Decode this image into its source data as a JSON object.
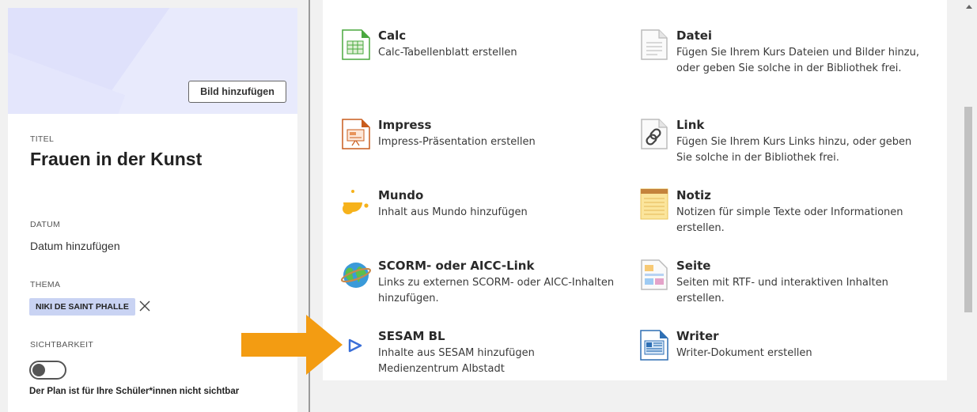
{
  "course": {
    "image_button": "Bild hinzufügen",
    "title_label": "TITEL",
    "title": "Frauen in der Kunst",
    "date_label": "DATUM",
    "date_value": "Datum hinzufügen",
    "topic_label": "THEMA",
    "topic_tag": "NIKI DE SAINT PHALLE",
    "visibility_label": "SICHTBARKEIT",
    "visibility_text": "Der Plan ist für Ihre Schüler*innen nicht sichtbar",
    "visibility_on": false
  },
  "items": [
    {
      "name": "Calc",
      "desc": "Calc-Tabellenblatt erstellen",
      "icon": "calc-icon"
    },
    {
      "name": "Datei",
      "desc": "Fügen Sie Ihrem Kurs Dateien und Bilder hinzu, oder geben Sie solche in der Bibliothek frei.",
      "icon": "file-icon"
    },
    {
      "name": "Impress",
      "desc": "Impress-Präsentation erstellen",
      "icon": "impress-icon"
    },
    {
      "name": "Link",
      "desc": "Fügen Sie Ihrem Kurs Links hinzu, oder geben Sie solche in der Bibliothek frei.",
      "icon": "link-icon"
    },
    {
      "name": "Mundo",
      "desc": "Inhalt aus Mundo hinzufügen",
      "icon": "mundo-icon"
    },
    {
      "name": "Notiz",
      "desc": "Notizen für simple Texte oder Informationen erstellen.",
      "icon": "note-icon"
    },
    {
      "name": "SCORM- oder AICC-Link",
      "desc": "Links zu externen SCORM- oder AICC-Inhalten hinzufügen.",
      "icon": "globe-icon"
    },
    {
      "name": "Seite",
      "desc": "Seiten mit RTF- und interaktiven Inhalten erstellen.",
      "icon": "page-icon"
    },
    {
      "name": "SESAM BL",
      "desc": "Inhalte aus SESAM hinzufügen Medienzentrum Albstadt",
      "icon": "play-icon"
    },
    {
      "name": "Writer",
      "desc": "Writer-Dokument erstellen",
      "icon": "writer-icon"
    }
  ],
  "colors": {
    "banner": "#dfe1fb",
    "tag": "#c9d3f3",
    "arrow": "#f39c12",
    "sesam_blue": "#3b6fd8"
  }
}
